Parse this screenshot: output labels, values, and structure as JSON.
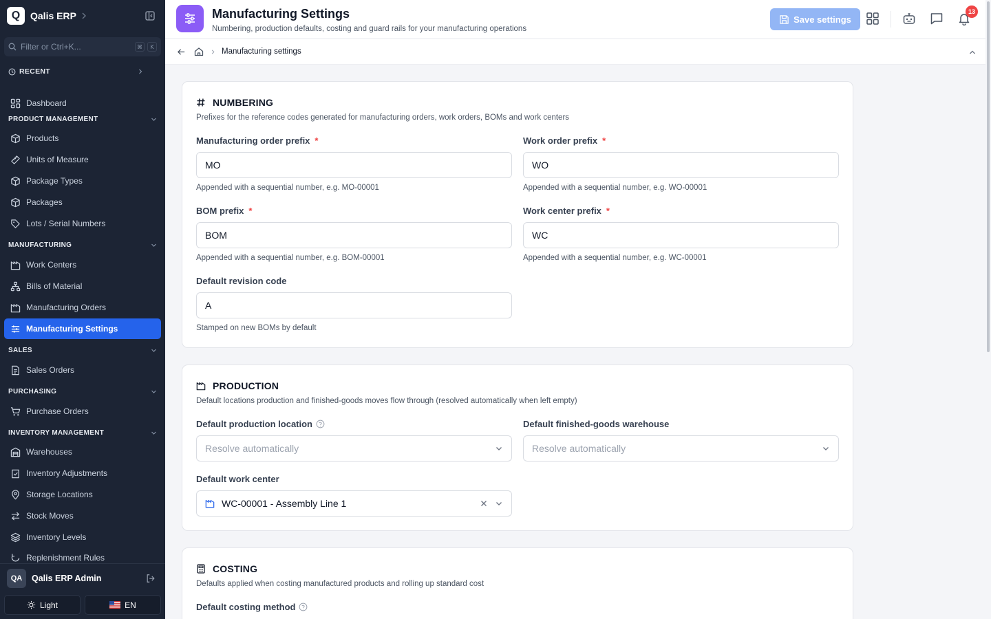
{
  "app": {
    "logo_letter": "Q",
    "name": "Qalis ERP"
  },
  "filter": {
    "placeholder": "Filter or Ctrl+K...",
    "kbd1": "⌘",
    "kbd2": "K"
  },
  "recent": {
    "label": "RECENT"
  },
  "nav": {
    "dashboard": "Dashboard",
    "product_section": "PRODUCT MANAGEMENT",
    "products": "Products",
    "uom": "Units of Measure",
    "package_types": "Package Types",
    "packages": "Packages",
    "lots": "Lots / Serial Numbers",
    "manufacturing_section": "MANUFACTURING",
    "work_centers": "Work Centers",
    "boms": "Bills of Material",
    "mos": "Manufacturing Orders",
    "mfg_settings": "Manufacturing Settings",
    "sales_section": "SALES",
    "sales_orders": "Sales Orders",
    "purchasing_section": "PURCHASING",
    "purchase_orders": "Purchase Orders",
    "inventory_section": "INVENTORY MANAGEMENT",
    "warehouses": "Warehouses",
    "adjustments": "Inventory Adjustments",
    "storage": "Storage Locations",
    "stock_moves": "Stock Moves",
    "levels": "Inventory Levels",
    "replenishment": "Replenishment Rules"
  },
  "user": {
    "initials": "QA",
    "name": "Qalis ERP Admin"
  },
  "footer": {
    "theme": "Light",
    "lang": "EN",
    "flag": "🇺🇸"
  },
  "header": {
    "title": "Manufacturing Settings",
    "subtitle": "Numbering, production defaults, costing and guard rails for your manufacturing operations",
    "save": "Save settings",
    "notifications": "13"
  },
  "breadcrumb": {
    "current": "Manufacturing settings"
  },
  "numbering": {
    "title": "NUMBERING",
    "desc": "Prefixes for the reference codes generated for manufacturing orders, work orders, BOMs and work centers",
    "mo_label": "Manufacturing order prefix",
    "mo_value": "MO",
    "mo_help": "Appended with a sequential number, e.g. MO-00001",
    "wo_label": "Work order prefix",
    "wo_value": "WO",
    "wo_help": "Appended with a sequential number, e.g. WO-00001",
    "bom_label": "BOM prefix",
    "bom_value": "BOM",
    "bom_help": "Appended with a sequential number, e.g. BOM-00001",
    "wc_label": "Work center prefix",
    "wc_value": "WC",
    "wc_help": "Appended with a sequential number, e.g. WC-00001",
    "rev_label": "Default revision code",
    "rev_value": "A",
    "rev_help": "Stamped on new BOMs by default",
    "required": "*"
  },
  "production": {
    "title": "PRODUCTION",
    "desc": "Default locations production and finished-goods moves flow through (resolved automatically when left empty)",
    "loc_label": "Default production location",
    "loc_value": "Resolve automatically",
    "fg_label": "Default finished-goods warehouse",
    "fg_value": "Resolve automatically",
    "wc_label": "Default work center",
    "wc_value": "WC-00001 - Assembly Line 1"
  },
  "costing": {
    "title": "COSTING",
    "desc": "Defaults applied when costing manufactured products and rolling up standard cost",
    "method_label": "Default costing method"
  },
  "colors": {
    "accent": "#2563eb",
    "sidebar": "#1c2434",
    "header_icon": "#8b5cf6",
    "required": "#ef4444"
  }
}
